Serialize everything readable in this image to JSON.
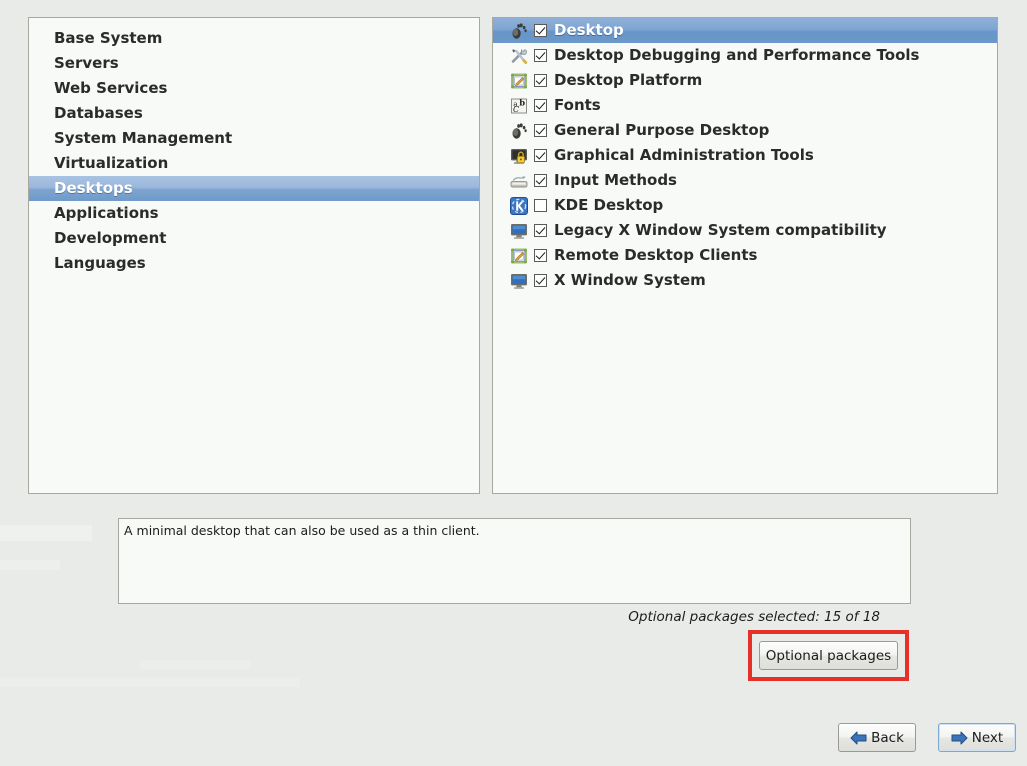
{
  "theme": {
    "background": "#e9ebe9",
    "panel_background": "#f7faf7",
    "panel_border": "#a8a8a0",
    "selection_blue": "#7da4ce",
    "highlight_red": "#e8302a",
    "arrow_blue": "#2a5faa"
  },
  "group_list": {
    "name": "package-group-list",
    "items": [
      {
        "label": "Base System",
        "selected": false
      },
      {
        "label": "Servers",
        "selected": false
      },
      {
        "label": "Web Services",
        "selected": false
      },
      {
        "label": "Databases",
        "selected": false
      },
      {
        "label": "System Management",
        "selected": false
      },
      {
        "label": "Virtualization",
        "selected": false
      },
      {
        "label": "Desktops",
        "selected": true
      },
      {
        "label": "Applications",
        "selected": false
      },
      {
        "label": "Development",
        "selected": false
      },
      {
        "label": "Languages",
        "selected": false
      }
    ]
  },
  "category_list": {
    "name": "package-category-list",
    "items": [
      {
        "label": "Desktop",
        "checked": true,
        "selected": true,
        "icon": "gnome-footprint-icon"
      },
      {
        "label": "Desktop Debugging and Performance Tools",
        "checked": true,
        "selected": false,
        "icon": "wrench-screwdriver-icon"
      },
      {
        "label": "Desktop Platform",
        "checked": true,
        "selected": false,
        "icon": "document-edit-icon"
      },
      {
        "label": "Fonts",
        "checked": true,
        "selected": false,
        "icon": "fonts-glyph-icon"
      },
      {
        "label": "General Purpose Desktop",
        "checked": true,
        "selected": false,
        "icon": "gnome-footprint-icon"
      },
      {
        "label": "Graphical Administration Tools",
        "checked": true,
        "selected": false,
        "icon": "monitor-lock-icon"
      },
      {
        "label": "Input Methods",
        "checked": true,
        "selected": false,
        "icon": "keyboard-icon"
      },
      {
        "label": "KDE Desktop",
        "checked": false,
        "selected": false,
        "icon": "kde-logo-icon"
      },
      {
        "label": "Legacy X Window System compatibility",
        "checked": true,
        "selected": false,
        "icon": "monitor-icon"
      },
      {
        "label": "Remote Desktop Clients",
        "checked": true,
        "selected": false,
        "icon": "document-edit-icon"
      },
      {
        "label": "X Window System",
        "checked": true,
        "selected": false,
        "icon": "monitor-icon"
      }
    ]
  },
  "description": {
    "text": "A minimal desktop that can also be used as a thin client."
  },
  "status": {
    "text": "Optional packages selected: 15 of 18"
  },
  "buttons": {
    "optional_packages": "Optional packages",
    "back": "Back",
    "next": "Next"
  }
}
